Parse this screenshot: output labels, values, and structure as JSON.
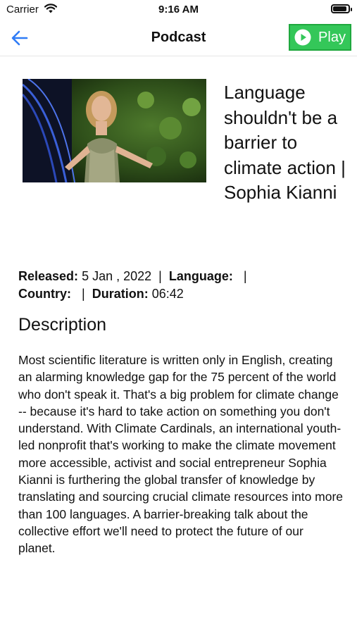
{
  "status_bar": {
    "carrier": "Carrier",
    "time": "9:16 AM"
  },
  "nav": {
    "title": "Podcast",
    "play_label": "Play",
    "icons": {
      "back": "arrow-left-icon",
      "play": "play-circle-icon"
    },
    "colors": {
      "back_arrow": "#2f7cf6",
      "play_bg": "#34c759"
    }
  },
  "episode": {
    "title": "Language shouldn't be a barrier to climate action | Sophia Kianni",
    "released_label": "Released:",
    "released_value": "5 Jan , 2022",
    "language_label": "Language:",
    "language_value": "",
    "country_label": "Country:",
    "country_value": "",
    "duration_label": "Duration:",
    "duration_value": "06:42"
  },
  "description": {
    "heading": "Description",
    "text": "Most scientific literature is written only in English, creating an alarming knowledge gap for the 75 percent of the world who don't speak it. That's a big problem for climate change -- because it's hard to take action on something you don't understand. With Climate Cardinals, an international youth-led nonprofit that's working to make the climate movement more accessible, activist and social entrepreneur Sophia Kianni is furthering the global transfer of knowledge by translating and sourcing crucial climate resources into more than 100 languages. A barrier-breaking talk about the collective effort we'll need to protect the future of our planet."
  }
}
